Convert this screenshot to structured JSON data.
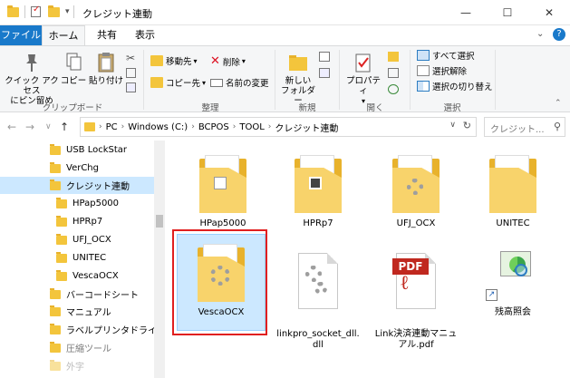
{
  "title": {
    "folder_title": "クレジット連動"
  },
  "window_buttons": {
    "minimize": "—",
    "maximize": "☐",
    "close": "✕"
  },
  "tabs": [
    {
      "label": "ファイル"
    },
    {
      "label": "ホーム"
    },
    {
      "label": "共有"
    },
    {
      "label": "表示"
    }
  ],
  "ribbon": {
    "pin_label": "クイック アクセス\nにピン留め",
    "copy_label": "コピー",
    "paste_label": "貼り付け",
    "move_label": "移動先",
    "copyto_label": "コピー先",
    "delete_label": "削除",
    "rename_label": "名前の変更",
    "newfolder_label": "新しい\nフォルダー",
    "properties_label": "プロパティ",
    "selectall_label": "すべて選択",
    "selectnone_label": "選択解除",
    "invert_label": "選択の切り替え",
    "groups": {
      "clipboard": "クリップボード",
      "organize": "整理",
      "new": "新規",
      "open": "開く",
      "select": "選択"
    }
  },
  "address": {
    "crumbs": [
      "PC",
      "Windows (C:)",
      "BCPOS",
      "TOOL",
      "クレジット連動"
    ],
    "search_placeholder": "クレジット..."
  },
  "nav_pane": {
    "items": [
      {
        "label": "USB LockStar",
        "indent": 0
      },
      {
        "label": "VerChg",
        "indent": 0
      },
      {
        "label": "クレジット連動",
        "indent": 0,
        "selected": true
      },
      {
        "label": "HPap5000",
        "indent": 1
      },
      {
        "label": "HPRp7",
        "indent": 1
      },
      {
        "label": "UFJ_OCX",
        "indent": 1
      },
      {
        "label": "UNITEC",
        "indent": 1
      },
      {
        "label": "VescaOCX",
        "indent": 1
      },
      {
        "label": "バーコードシート",
        "indent": 0
      },
      {
        "label": "マニュアル",
        "indent": 0
      },
      {
        "label": "ラベルプリンタドライバ",
        "indent": 0
      },
      {
        "label": "圧縮ツール",
        "indent": 0
      },
      {
        "label": "外字",
        "indent": 0
      }
    ]
  },
  "content": {
    "items": [
      {
        "label": "HPap5000",
        "kind": "folder"
      },
      {
        "label": "HPRp7",
        "kind": "folder"
      },
      {
        "label": "UFJ_OCX",
        "kind": "folder"
      },
      {
        "label": "UNITEC",
        "kind": "folder"
      },
      {
        "label": "VescaOCX",
        "kind": "folder",
        "selected": true
      },
      {
        "label": "linkpro_socket_dll.\ndll",
        "kind": "dll"
      },
      {
        "label": "Link決済連動マニュ\nアル.pdf",
        "kind": "pdf"
      },
      {
        "label": "残高照会",
        "kind": "shortcut"
      }
    ]
  },
  "colors": {
    "accent": "#1979ca",
    "selection": "#cce8ff",
    "folder": "#f3c53c",
    "highlight_outline": "#e02020"
  }
}
